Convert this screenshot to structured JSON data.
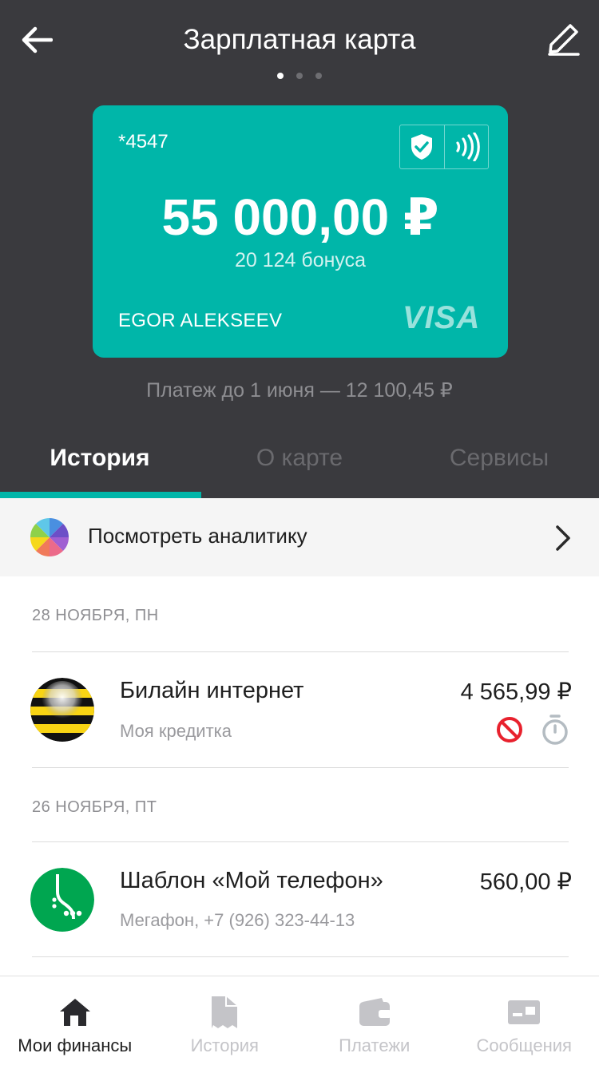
{
  "header": {
    "title": "Зарплатная карта",
    "back_icon": "arrow-left-icon",
    "edit_icon": "pen-icon",
    "pager": {
      "count": 3,
      "active": 1
    }
  },
  "card": {
    "number": "*4547",
    "balance": "55 000,00 ₽",
    "bonus": "20 124 бонуса",
    "holder": "EGOR ALEKSEEV",
    "brand": "VISA",
    "color": "#00b6a9",
    "icons": [
      "shield-check-icon",
      "contactless-icon"
    ]
  },
  "payment_note": "Платеж до 1 июня — 12 100,45 ₽",
  "tabs": [
    {
      "label": "История",
      "active": true
    },
    {
      "label": "О карте",
      "active": false
    },
    {
      "label": "Сервисы",
      "active": false
    }
  ],
  "analytics": {
    "label": "Посмотреть аналитику",
    "icon": "pie-chart-icon"
  },
  "groups": [
    {
      "date": "28 НОЯБРЯ, ПН",
      "transactions": [
        {
          "title": "Билайн интернет",
          "subtitle": "Моя кредитка",
          "amount": "4 565,99 ₽",
          "logo": "beeline-logo",
          "status_icons": [
            "blocked-icon",
            "stopwatch-icon"
          ]
        }
      ]
    },
    {
      "date": "26 НОЯБРЯ, ПТ",
      "transactions": [
        {
          "title": "Шаблон «Мой телефон»",
          "subtitle": "Мегафон, +7 (926) 323-44-13",
          "amount": "560,00 ₽",
          "logo": "megafon-logo"
        }
      ]
    }
  ],
  "bottom_nav": [
    {
      "label": "Мои финансы",
      "icon": "home-icon",
      "active": true
    },
    {
      "label": "История",
      "icon": "receipt-icon",
      "active": false
    },
    {
      "label": "Платежи",
      "icon": "wallet-icon",
      "active": false
    },
    {
      "label": "Сообщения",
      "icon": "message-card-icon",
      "active": false
    }
  ],
  "colors": {
    "accent": "#00b6a9",
    "header_bg": "#3a3a3e",
    "danger": "#e8212d"
  }
}
